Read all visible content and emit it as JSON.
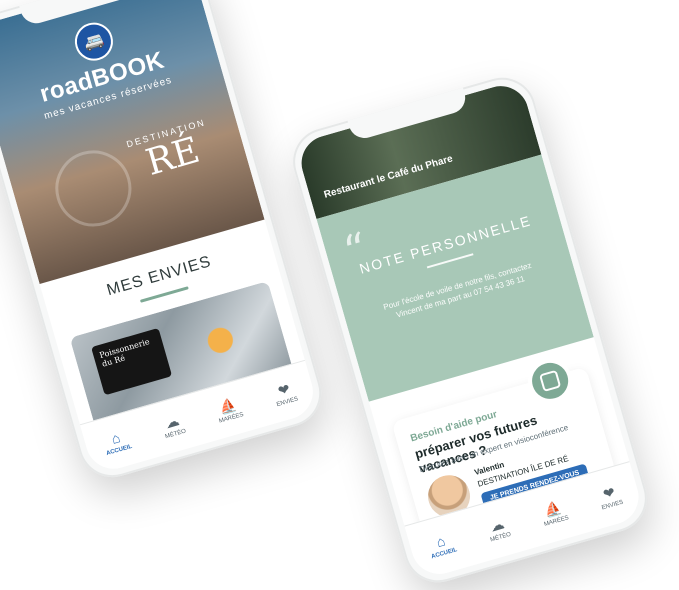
{
  "left_phone": {
    "logo_icon": "camper-van-icon",
    "brand_name": "roadBOOK",
    "brand_tagline": "mes vacances réservées",
    "destination_label": "DESTINATION",
    "destination_name": "RÉ",
    "section_title": "MES ENVIES",
    "photo_sign_text": "Poissonnerie du Ré",
    "tabs": [
      {
        "label": "ACCUEIL",
        "icon": "home-icon"
      },
      {
        "label": "MÉTÉO",
        "icon": "cloud-icon"
      },
      {
        "label": "MARÉES",
        "icon": "boat-icon"
      },
      {
        "label": "ENVIES",
        "icon": "heart-icon"
      }
    ]
  },
  "right_phone": {
    "top_title": "Restaurant le Café du Phare",
    "note_title": "NOTE PERSONNELLE",
    "note_text": "Pour l'école de voile de notre fils, contactez Vincent de ma part au 07 54 43 36 11",
    "help_kicker": "Besoin d'aide pour",
    "help_title": "préparer vos futures vacances ?",
    "help_subtitle": "Discutez avec un expert en visioconférence",
    "expert_name": "Valentin",
    "expert_role": "DESTINATION ÎLE DE RÉ",
    "cta_label": "JE PRENDS RENDEZ-VOUS",
    "tabs": [
      {
        "label": "ACCUEIL",
        "icon": "home-icon"
      },
      {
        "label": "MÉTÉO",
        "icon": "cloud-icon"
      },
      {
        "label": "MARÉES",
        "icon": "boat-icon"
      },
      {
        "label": "ENVIES",
        "icon": "heart-icon"
      }
    ]
  },
  "colors": {
    "accent_green": "#7ea995",
    "accent_blue": "#2d6db7",
    "note_bg": "#a8c8b7"
  }
}
